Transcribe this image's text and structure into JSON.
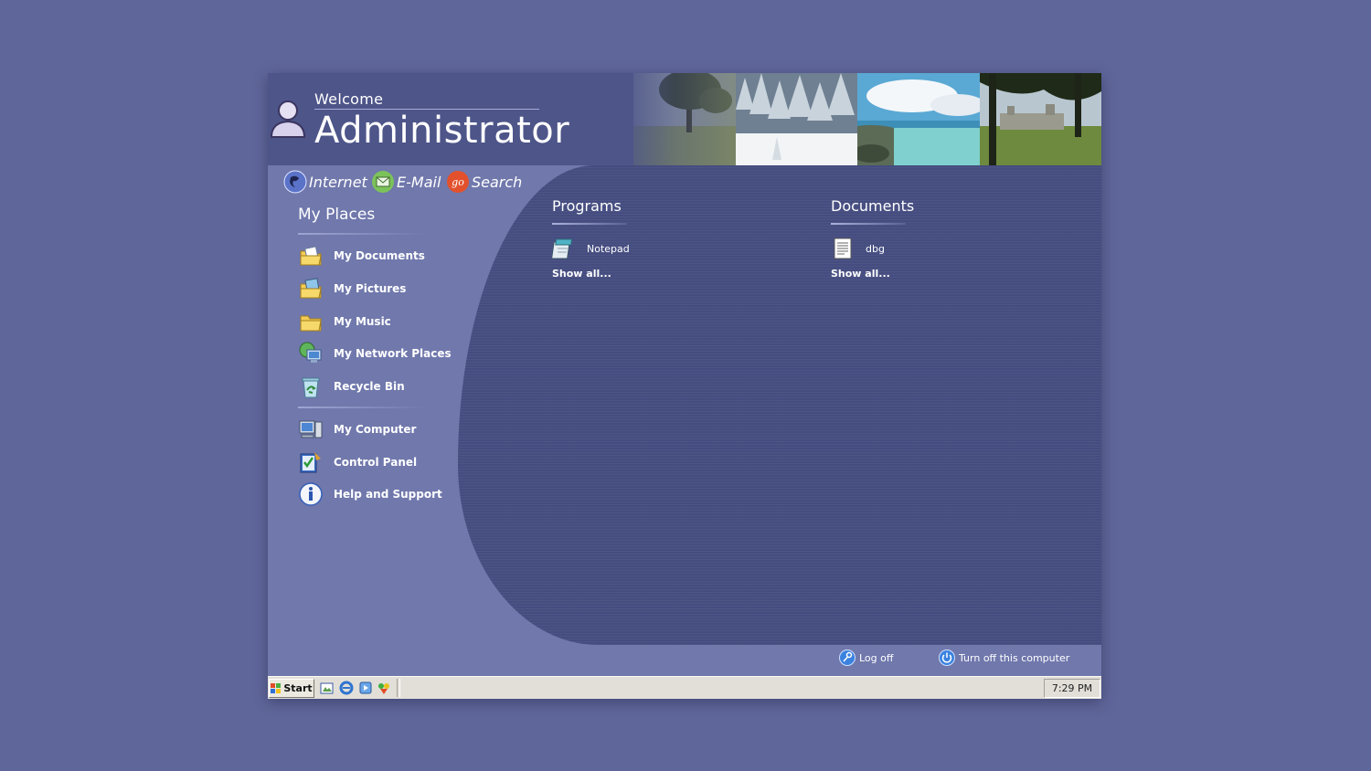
{
  "header": {
    "welcome_label": "Welcome",
    "username": "Administrator",
    "avatar_icon": "user-icon",
    "photos": [
      "park-tree-photo",
      "snowy-forest-photo",
      "tropical-beach-photo",
      "chateau-photo"
    ]
  },
  "quick_links": [
    {
      "label": "Internet",
      "icon": "globe-icon"
    },
    {
      "label": "E-Mail",
      "icon": "envelope-icon"
    },
    {
      "label": "Search",
      "icon": "go-search-icon"
    }
  ],
  "places": {
    "title": "My Places",
    "group1": [
      {
        "label": "My Documents",
        "icon": "documents-folder-icon"
      },
      {
        "label": "My Pictures",
        "icon": "pictures-folder-icon"
      },
      {
        "label": "My Music",
        "icon": "music-folder-icon"
      },
      {
        "label": "My Network Places",
        "icon": "network-places-icon"
      },
      {
        "label": "Recycle Bin",
        "icon": "recycle-bin-icon"
      }
    ],
    "group2": [
      {
        "label": "My Computer",
        "icon": "computer-icon"
      },
      {
        "label": "Control Panel",
        "icon": "control-panel-icon"
      },
      {
        "label": "Help and Support",
        "icon": "help-icon"
      }
    ]
  },
  "programs": {
    "title": "Programs",
    "items": [
      {
        "label": "Notepad",
        "icon": "notepad-icon"
      }
    ],
    "show_all": "Show all..."
  },
  "documents": {
    "title": "Documents",
    "items": [
      {
        "label": "dbg",
        "icon": "text-document-icon"
      }
    ],
    "show_all": "Show all..."
  },
  "actions": {
    "log_off": "Log off",
    "turn_off": "Turn off this computer"
  },
  "taskbar": {
    "start_label": "Start",
    "clock": "7:29 PM",
    "quick_launch": [
      "show-desktop-icon",
      "internet-explorer-icon",
      "media-player-icon",
      "messenger-icon"
    ]
  },
  "colors": {
    "desktop": "#5f6699",
    "header": "#4d5589",
    "left_panel": "#7078ac",
    "right_panel": "#454d80",
    "taskbar": "#e1dfd8"
  }
}
